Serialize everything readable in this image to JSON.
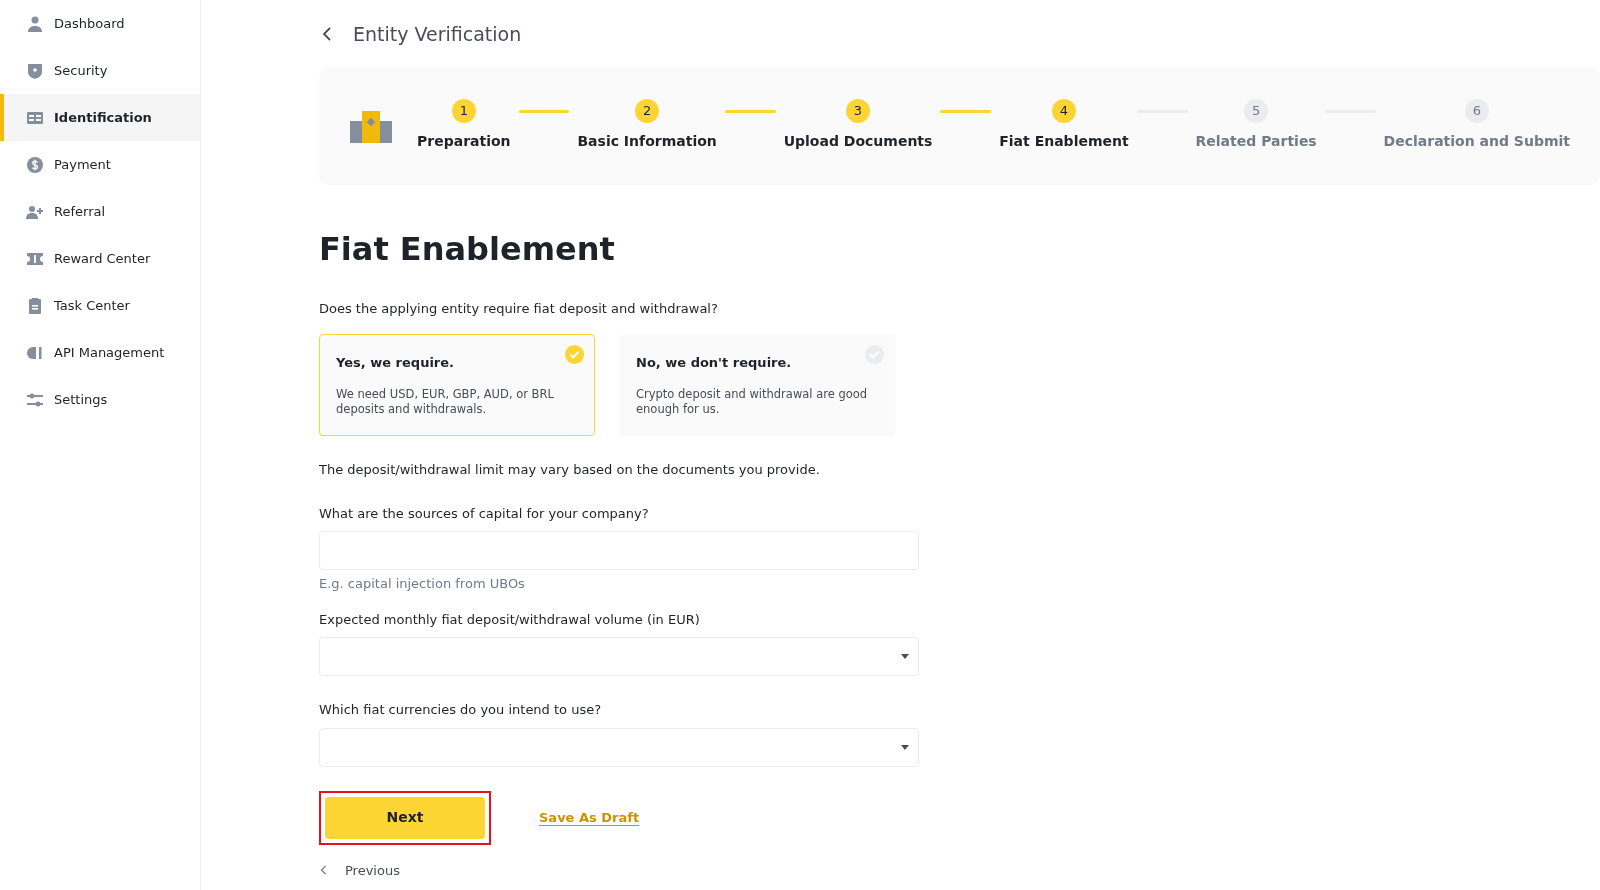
{
  "sidebar": {
    "items": [
      {
        "label": "Dashboard",
        "selected": false
      },
      {
        "label": "Security",
        "selected": false
      },
      {
        "label": "Identification",
        "selected": true
      },
      {
        "label": "Payment",
        "selected": false
      },
      {
        "label": "Referral",
        "selected": false
      },
      {
        "label": "Reward Center",
        "selected": false
      },
      {
        "label": "Task Center",
        "selected": false
      },
      {
        "label": "API Management",
        "selected": false
      },
      {
        "label": "Settings",
        "selected": false
      }
    ]
  },
  "header": {
    "title": "Entity Verification"
  },
  "steps": [
    {
      "number": "1",
      "label": "Preparation",
      "completed": true
    },
    {
      "number": "2",
      "label": "Basic Information",
      "completed": true
    },
    {
      "number": "3",
      "label": "Upload Documents",
      "completed": true
    },
    {
      "number": "4",
      "label": "Fiat Enablement",
      "completed": true
    },
    {
      "number": "5",
      "label": "Related Parties",
      "completed": false
    },
    {
      "number": "6",
      "label": "Declaration and Submit",
      "completed": false
    }
  ],
  "page_title": "Fiat Enablement",
  "question": "Does the applying entity require fiat deposit and withdrawal?",
  "options": [
    {
      "title": "Yes, we require.",
      "description": "We need USD, EUR, GBP, AUD, or BRL deposits and withdrawals.",
      "selected": true
    },
    {
      "title": "No, we don't require.",
      "description": "Crypto deposit and withdrawal are good enough for us.",
      "selected": false
    }
  ],
  "note": "The deposit/withdrawal limit may vary based on the documents you provide.",
  "fields": [
    {
      "kind": "text",
      "label": "What are the sources of capital for your company?",
      "hint": "E.g. capital injection from UBOs"
    },
    {
      "kind": "select",
      "label": "Expected monthly fiat deposit/withdrawal volume (in EUR)"
    },
    {
      "kind": "select",
      "label": "Which fiat currencies do you intend to use?"
    }
  ],
  "actions": {
    "next": "Next",
    "next_highlighted": true,
    "save_draft": "Save As Draft",
    "previous": "Previous"
  }
}
